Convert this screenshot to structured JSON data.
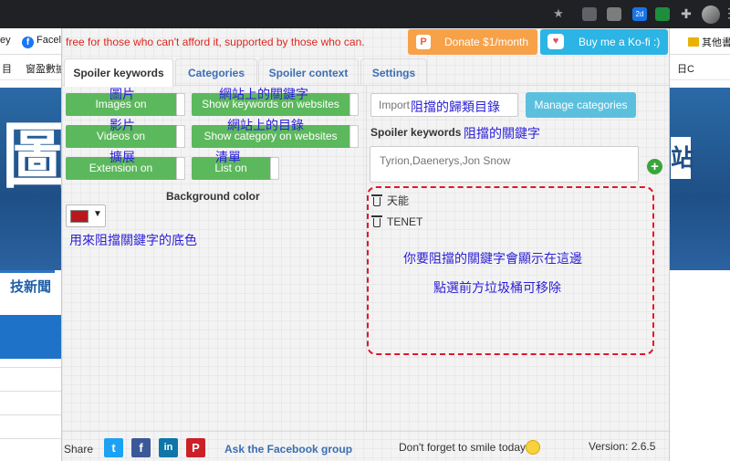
{
  "browser": {
    "bookmarks": [
      {
        "label": "ey"
      },
      {
        "label": "Facel"
      },
      {
        "label": "其他書"
      }
    ],
    "extension_badge": "2d"
  },
  "site": {
    "nav_items": [
      "目",
      "窗盈數據",
      "日C"
    ],
    "logo_text": "圖",
    "right_char": "站",
    "tab_text": "技新聞"
  },
  "popup": {
    "tagline": "free for those who can't afford it, supported by those who can.",
    "donate_label": "Donate $1/month",
    "kofi_label": "Buy me a Ko-fi :)",
    "tabs": [
      {
        "label": "Spoiler keywords",
        "active": true
      },
      {
        "label": "Categories",
        "active": false
      },
      {
        "label": "Spoiler context",
        "active": false
      },
      {
        "label": "Settings",
        "active": false
      }
    ],
    "toggles": {
      "images": "Images on",
      "videos": "Videos on",
      "extension": "Extension on",
      "show_keywords": "Show keywords on websites",
      "show_category": "Show category on websites",
      "list": "List on"
    },
    "background_color_label": "Background color",
    "background_color_value": "#b9171c",
    "category_placeholder": "Import",
    "manage_categories_label": "Manage categories",
    "keywords_label": "Spoiler keywords",
    "keywords_placeholder": "Tyrion,Daenerys,Jon Snow",
    "keywords": [
      "天能",
      "TENET"
    ],
    "footer": {
      "share": "Share",
      "social": [
        "t",
        "f",
        "in",
        "P"
      ],
      "fb_group": "Ask the Facebook group",
      "smile": "Don't forget to smile today",
      "version": "Version: 2.6.5"
    }
  },
  "annotations": {
    "images": "圖片",
    "videos": "影片",
    "extension": "擴展",
    "show_keywords": "網站上的關鍵字",
    "show_category": "網站上的目錄",
    "list": "清單",
    "bg_color": "用來阻擋關鍵字的底色",
    "category": "阻擋的歸類目錄",
    "keywords": "阻擋的關鍵字",
    "box_line1": "你要阻擋的關鍵字會顯示在這邊",
    "box_line2": "點選前方垃圾桶可移除"
  }
}
